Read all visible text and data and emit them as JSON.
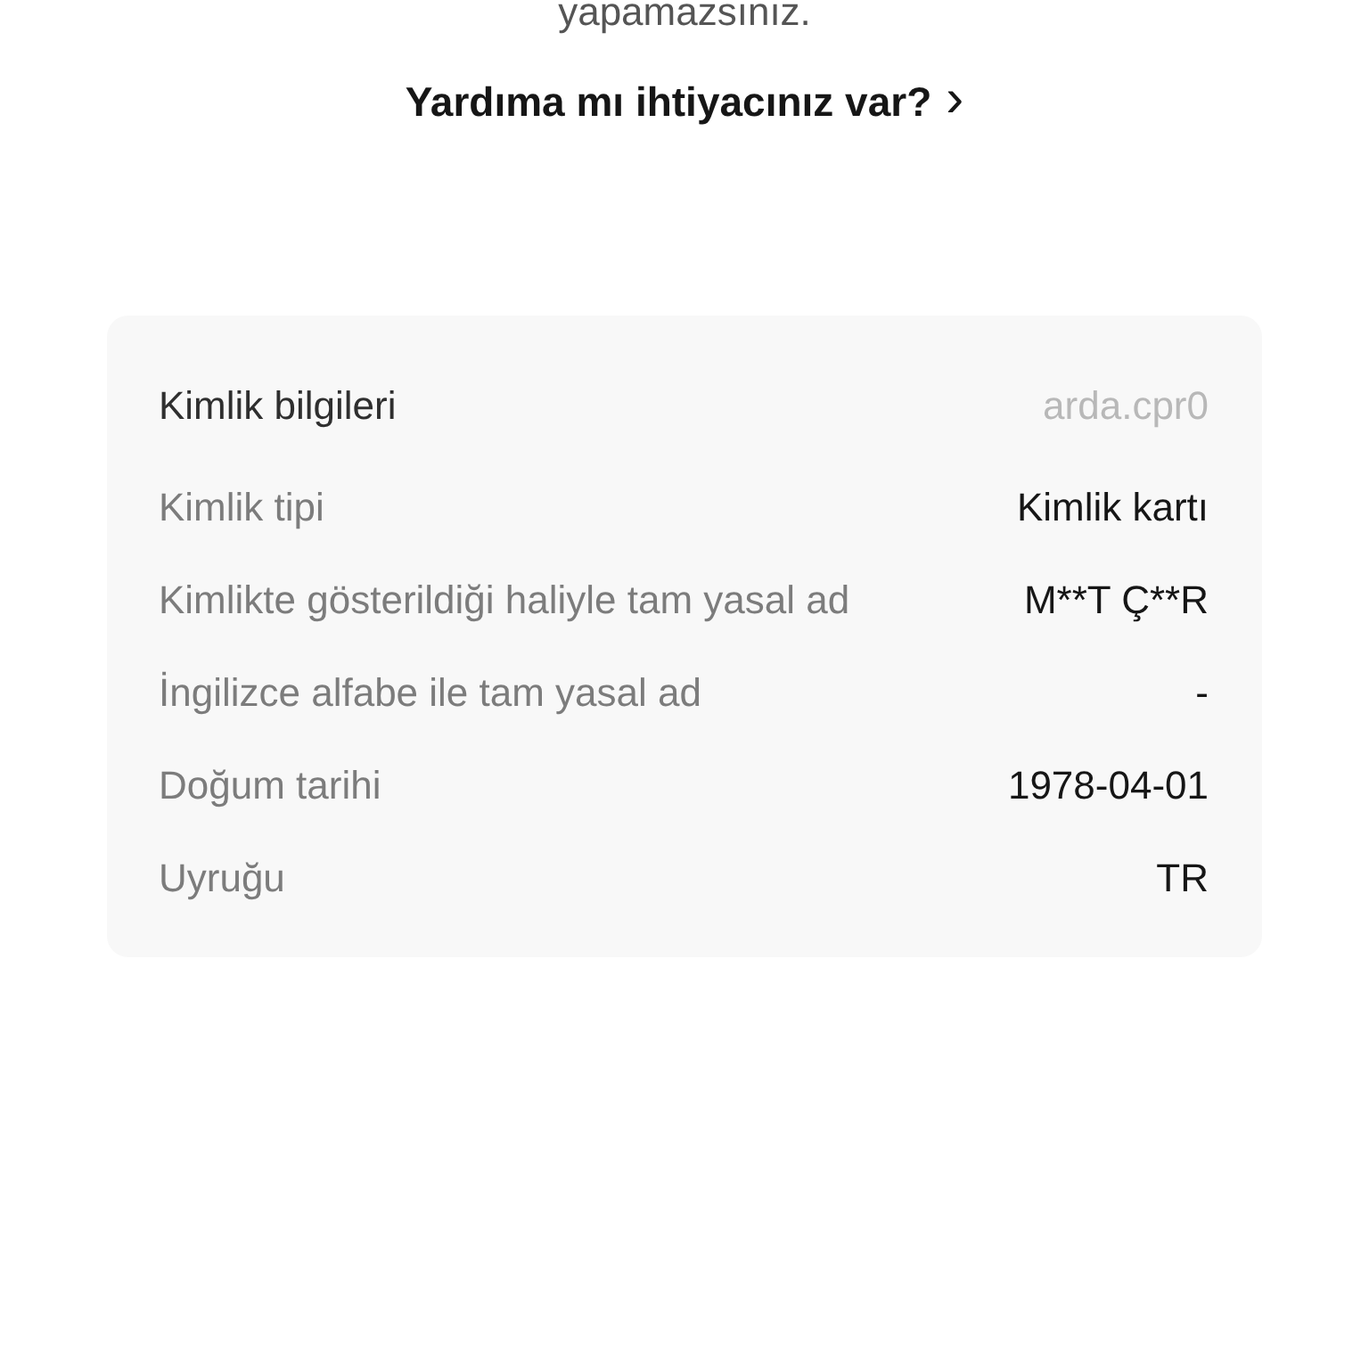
{
  "notice_tail": "yapamazsınız.",
  "help_link": {
    "label": "Yardıma mı ihtiyacınız var?",
    "chevron": "›"
  },
  "identity_card": {
    "title": "Kimlik bilgileri",
    "username": "arda.cpr0",
    "rows": [
      {
        "label": "Kimlik tipi",
        "value": "Kimlik kartı"
      },
      {
        "label": "Kimlikte gösterildiği haliyle tam yasal ad",
        "value": "M**T Ç**R"
      },
      {
        "label": "İngilizce alfabe ile tam yasal ad",
        "value": "-"
      },
      {
        "label": "Doğum tarihi",
        "value": "1978-04-01"
      },
      {
        "label": "Uyruğu",
        "value": "TR"
      }
    ]
  }
}
